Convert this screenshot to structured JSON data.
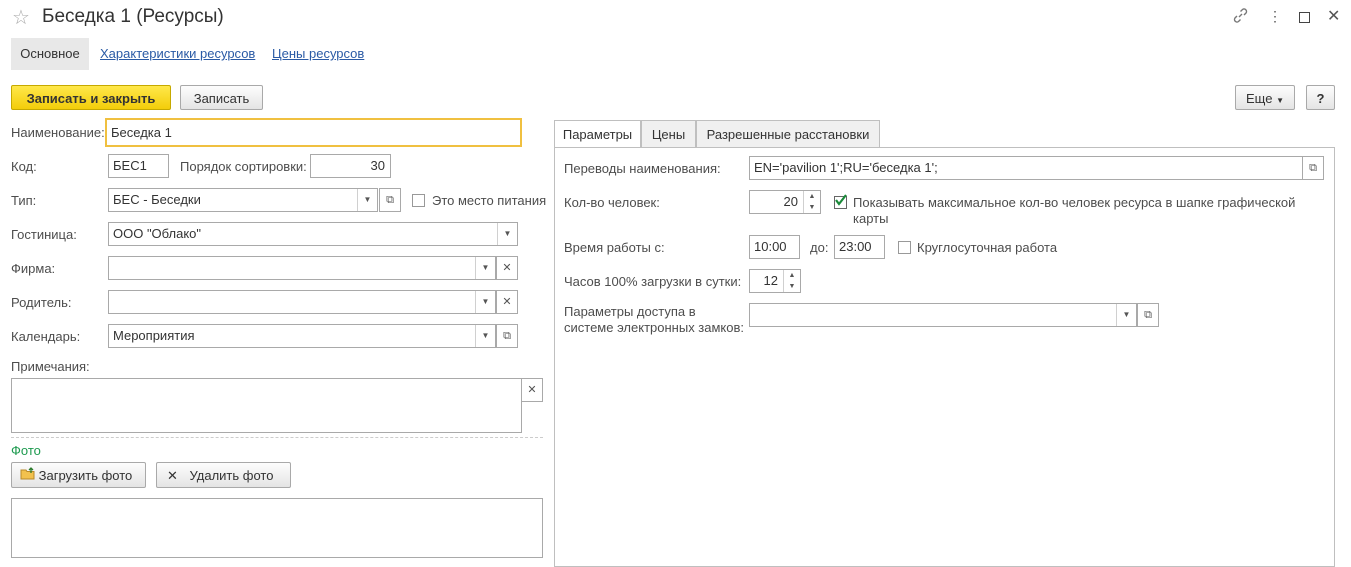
{
  "window": {
    "title": "Беседка 1 (Ресурсы)",
    "icons": [
      "star-icon",
      "link-icon",
      "more-vert-icon",
      "maximize-icon",
      "close-icon"
    ]
  },
  "nav": {
    "main": "Основное",
    "characteristics": "Характеристики ресурсов",
    "prices": "Цены ресурсов"
  },
  "toolbar": {
    "save_close": "Записать и закрыть",
    "save": "Записать",
    "more": "Еще",
    "help": "?"
  },
  "left": {
    "name_label": "Наименование:",
    "name_value": "Беседка 1",
    "code_label": "Код:",
    "code_value": "БЕС1",
    "sort_label": "Порядок сортировки:",
    "sort_value": "30",
    "type_label": "Тип:",
    "type_value": "БЕС - Беседки",
    "food_place_label": "Это место питания",
    "hotel_label": "Гостиница:",
    "hotel_value": "ООО \"Облако\"",
    "firm_label": "Фирма:",
    "firm_value": "",
    "parent_label": "Родитель:",
    "parent_value": "",
    "calendar_label": "Календарь:",
    "calendar_value": "Мероприятия",
    "notes_label": "Примечания:",
    "photo_label": "Фото",
    "upload_photo": "Загрузить фото",
    "delete_photo": "Удалить фото"
  },
  "right": {
    "tabs": [
      "Параметры",
      "Цены",
      "Разрешенные расстановки"
    ],
    "translations_label": "Переводы наименования:",
    "translations_value": "EN='pavilion 1';RU='беседка 1';",
    "people_label": "Кол-во человек:",
    "people_value": "20",
    "show_max_label": "Показывать максимальное кол-во человек ресурса в шапке графической карты",
    "show_max_checked": true,
    "work_from_label": "Время работы с:",
    "work_from_value": "10:00",
    "work_to_label": "до:",
    "work_to_value": "23:00",
    "allday_label": "Круглосуточная работа",
    "hours_label": "Часов 100% загрузки в сутки:",
    "hours_value": "12",
    "access_label": "Параметры доступа в системе электронных замков:",
    "access_value": ""
  },
  "colors": {
    "primary_button": "#f3cd0a",
    "link": "#2a5aa5",
    "photo_label": "#1d9a4f",
    "focus_border": "#f0c040"
  }
}
